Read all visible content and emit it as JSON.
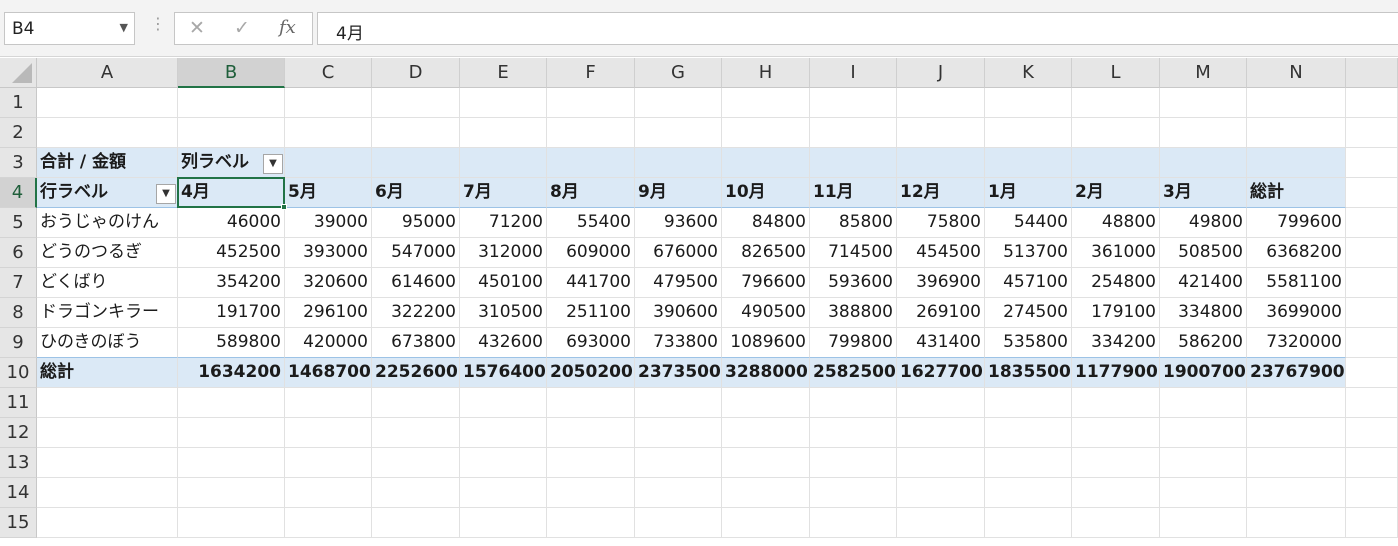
{
  "formula_bar": {
    "name_box": "B4",
    "cancel_icon": "✕",
    "enter_icon": "✓",
    "fx_label": "fx",
    "formula": "4月"
  },
  "columns": [
    "A",
    "B",
    "C",
    "D",
    "E",
    "F",
    "G",
    "H",
    "I",
    "J",
    "K",
    "L",
    "M",
    "N"
  ],
  "rows": [
    "1",
    "2",
    "3",
    "4",
    "5",
    "6",
    "7",
    "8",
    "9",
    "10",
    "11",
    "12",
    "13",
    "14",
    "15"
  ],
  "selected_cell": "B4",
  "pivot": {
    "summary_label": "合計 / 金額",
    "column_labels_caption": "列ラベル",
    "row_labels_caption": "行ラベル",
    "month_headers": [
      "4月",
      "5月",
      "6月",
      "7月",
      "8月",
      "9月",
      "10月",
      "11月",
      "12月",
      "1月",
      "2月",
      "3月",
      "総計"
    ],
    "data_rows": [
      {
        "label": "おうじゃのけん",
        "values": [
          "46000",
          "39000",
          "95000",
          "71200",
          "55400",
          "93600",
          "84800",
          "85800",
          "75800",
          "54400",
          "48800",
          "49800",
          "799600"
        ]
      },
      {
        "label": "どうのつるぎ",
        "values": [
          "452500",
          "393000",
          "547000",
          "312000",
          "609000",
          "676000",
          "826500",
          "714500",
          "454500",
          "513700",
          "361000",
          "508500",
          "6368200"
        ]
      },
      {
        "label": "どくばり",
        "values": [
          "354200",
          "320600",
          "614600",
          "450100",
          "441700",
          "479500",
          "796600",
          "593600",
          "396900",
          "457100",
          "254800",
          "421400",
          "5581100"
        ]
      },
      {
        "label": "ドラゴンキラー",
        "values": [
          "191700",
          "296100",
          "322200",
          "310500",
          "251100",
          "390600",
          "490500",
          "388800",
          "269100",
          "274500",
          "179100",
          "334800",
          "3699000"
        ]
      },
      {
        "label": "ひのきのぼう",
        "values": [
          "589800",
          "420000",
          "673800",
          "432600",
          "693000",
          "733800",
          "1089600",
          "799800",
          "431400",
          "535800",
          "334200",
          "586200",
          "7320000"
        ]
      }
    ],
    "total_row": {
      "label": "総計",
      "values": [
        "1634200",
        "1468700",
        "2252600",
        "1576400",
        "2050200",
        "2373500",
        "3288000",
        "2582500",
        "1627700",
        "1835500",
        "1177900",
        "1900700",
        "23767900"
      ]
    }
  },
  "colors": {
    "pivot_fill": "#dbe9f6",
    "selection_accent": "#217346"
  }
}
